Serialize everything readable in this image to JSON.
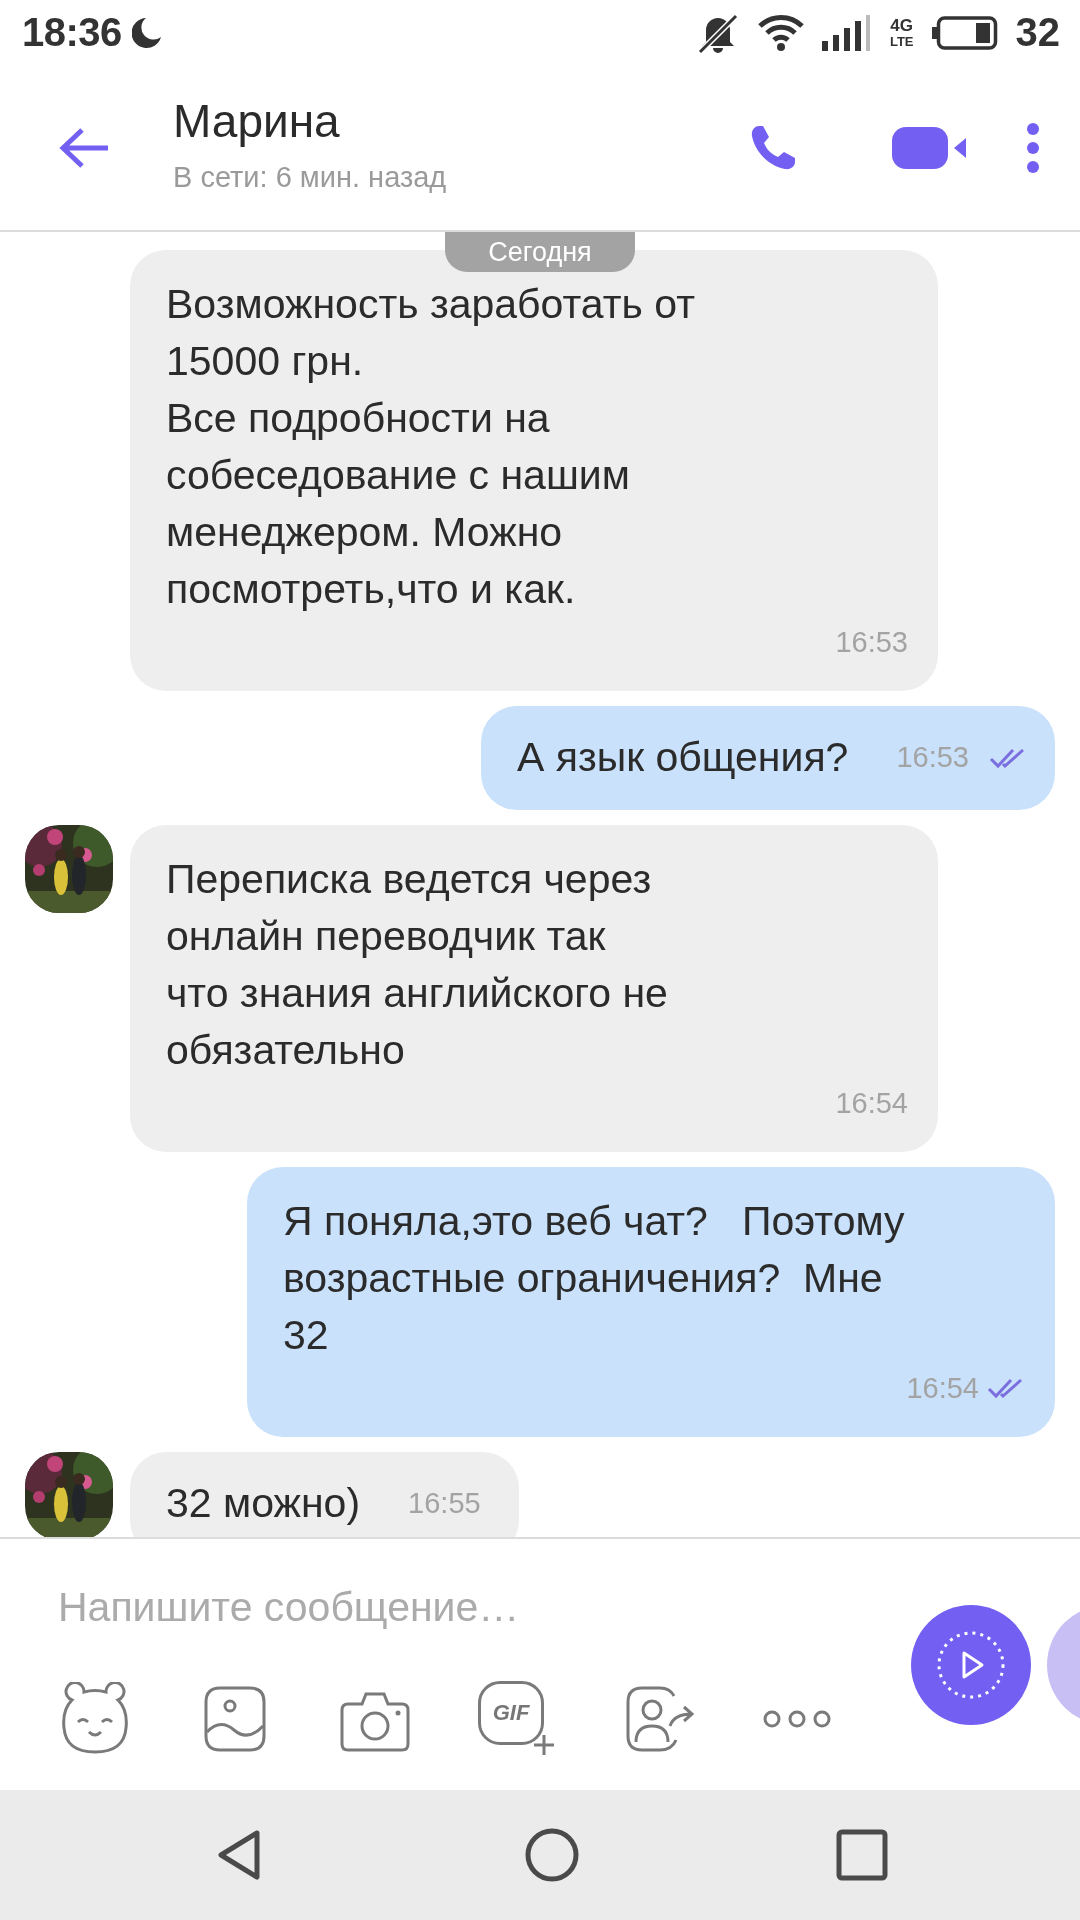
{
  "status_bar": {
    "time": "18:36",
    "network": "4G",
    "network_sub": "LTE",
    "battery": "32"
  },
  "header": {
    "title": "Марина",
    "subtitle": "В сети: 6 мин. назад"
  },
  "date_badge": "Сегодня",
  "messages": [
    {
      "kind": "incoming",
      "avatar": false,
      "text": "Возможность заработать от\n15000 грн.\nВсе подробности на\nсобеседование с нашим\nменеджером. Можно\nпосмотреть,что и как.",
      "time": "16:53"
    },
    {
      "kind": "outgoing",
      "text": "А язык общения?",
      "time": "16:53",
      "read": true
    },
    {
      "kind": "incoming",
      "avatar": true,
      "text": "Переписка ведется через\nонлайн переводчик так\nчто знания английского не\nобязательно",
      "time": "16:54"
    },
    {
      "kind": "outgoing",
      "text": "Я поняла,это веб чат?   Поэтому\nвозрастные ограничения?  Мне\n32",
      "time": "16:54",
      "read": true
    },
    {
      "kind": "incoming",
      "avatar": true,
      "text": "32 можно)",
      "time": "16:55"
    }
  ],
  "composer": {
    "placeholder": "Напишите сообщение…",
    "gif_label": "GIF"
  }
}
